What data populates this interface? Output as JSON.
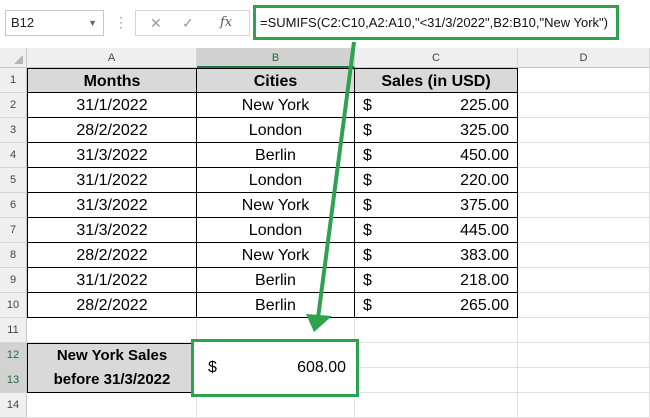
{
  "formula_bar": {
    "name_box": "B12",
    "formula": "=SUMIFS(C2:C10,A2:A10,\"<31/3/2022\",B2:B10,\"New York\")"
  },
  "columns": [
    "A",
    "B",
    "C",
    "D"
  ],
  "row_numbers": [
    "1",
    "2",
    "3",
    "4",
    "5",
    "6",
    "7",
    "8",
    "9",
    "10",
    "11",
    "12",
    "13",
    "14"
  ],
  "table": {
    "headers": [
      "Months",
      "Cities",
      "Sales (in USD)"
    ],
    "rows": [
      {
        "month": "31/1/2022",
        "city": "New York",
        "currency": "$",
        "sales": "225.00"
      },
      {
        "month": "28/2/2022",
        "city": "London",
        "currency": "$",
        "sales": "325.00"
      },
      {
        "month": "31/3/2022",
        "city": "Berlin",
        "currency": "$",
        "sales": "450.00"
      },
      {
        "month": "31/1/2022",
        "city": "London",
        "currency": "$",
        "sales": "220.00"
      },
      {
        "month": "31/3/2022",
        "city": "New York",
        "currency": "$",
        "sales": "375.00"
      },
      {
        "month": "31/3/2022",
        "city": "London",
        "currency": "$",
        "sales": "445.00"
      },
      {
        "month": "28/2/2022",
        "city": "New York",
        "currency": "$",
        "sales": "383.00"
      },
      {
        "month": "31/1/2022",
        "city": "Berlin",
        "currency": "$",
        "sales": "218.00"
      },
      {
        "month": "28/2/2022",
        "city": "Berlin",
        "currency": "$",
        "sales": "265.00"
      }
    ]
  },
  "result": {
    "label_line1": "New York Sales",
    "label_line2": "before 31/3/2022",
    "currency": "$",
    "value": "608.00"
  },
  "colors": {
    "highlight": "#2ea34f",
    "header_fill": "#d9d9d9",
    "excel_green": "#217346"
  }
}
